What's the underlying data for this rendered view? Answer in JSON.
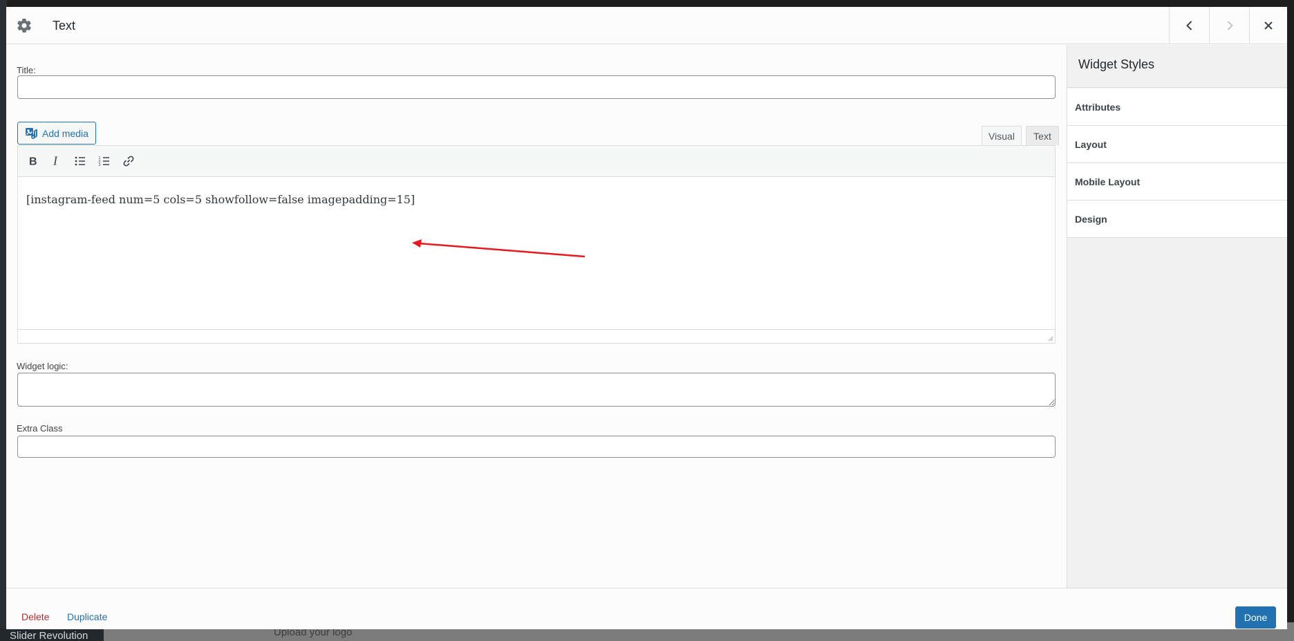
{
  "background": {
    "admin_menu_item": "Slider Revolution",
    "page_hint": "Upload your logo"
  },
  "modal": {
    "title": "Text",
    "header_icons": {
      "settings": "gear-icon",
      "previous": "chevron-left-icon",
      "next": "chevron-right-icon",
      "close": "close-icon"
    }
  },
  "form": {
    "title_label": "Title:",
    "title_value": "",
    "add_media_label": "Add media",
    "editor_tabs": [
      "Visual",
      "Text"
    ],
    "active_tab": "Visual",
    "toolbar": [
      "bold-icon",
      "italic-icon",
      "bullet-list-icon",
      "numbered-list-icon",
      "link-icon"
    ],
    "editor_content": "[instagram-feed num=5 cols=5 showfollow=false imagepadding=15]",
    "widget_logic_label": "Widget logic:",
    "widget_logic_value": "",
    "extra_class_label": "Extra Class",
    "extra_class_value": ""
  },
  "sidebar": {
    "title": "Widget Styles",
    "items": [
      {
        "label": "Attributes"
      },
      {
        "label": "Layout"
      },
      {
        "label": "Mobile Layout"
      },
      {
        "label": "Design"
      }
    ]
  },
  "footer": {
    "delete_label": "Delete",
    "duplicate_label": "Duplicate",
    "done_label": "Done"
  },
  "colors": {
    "primary": "#2271b1",
    "danger": "#b32d2e",
    "annotation_arrow": "#e8191e"
  }
}
